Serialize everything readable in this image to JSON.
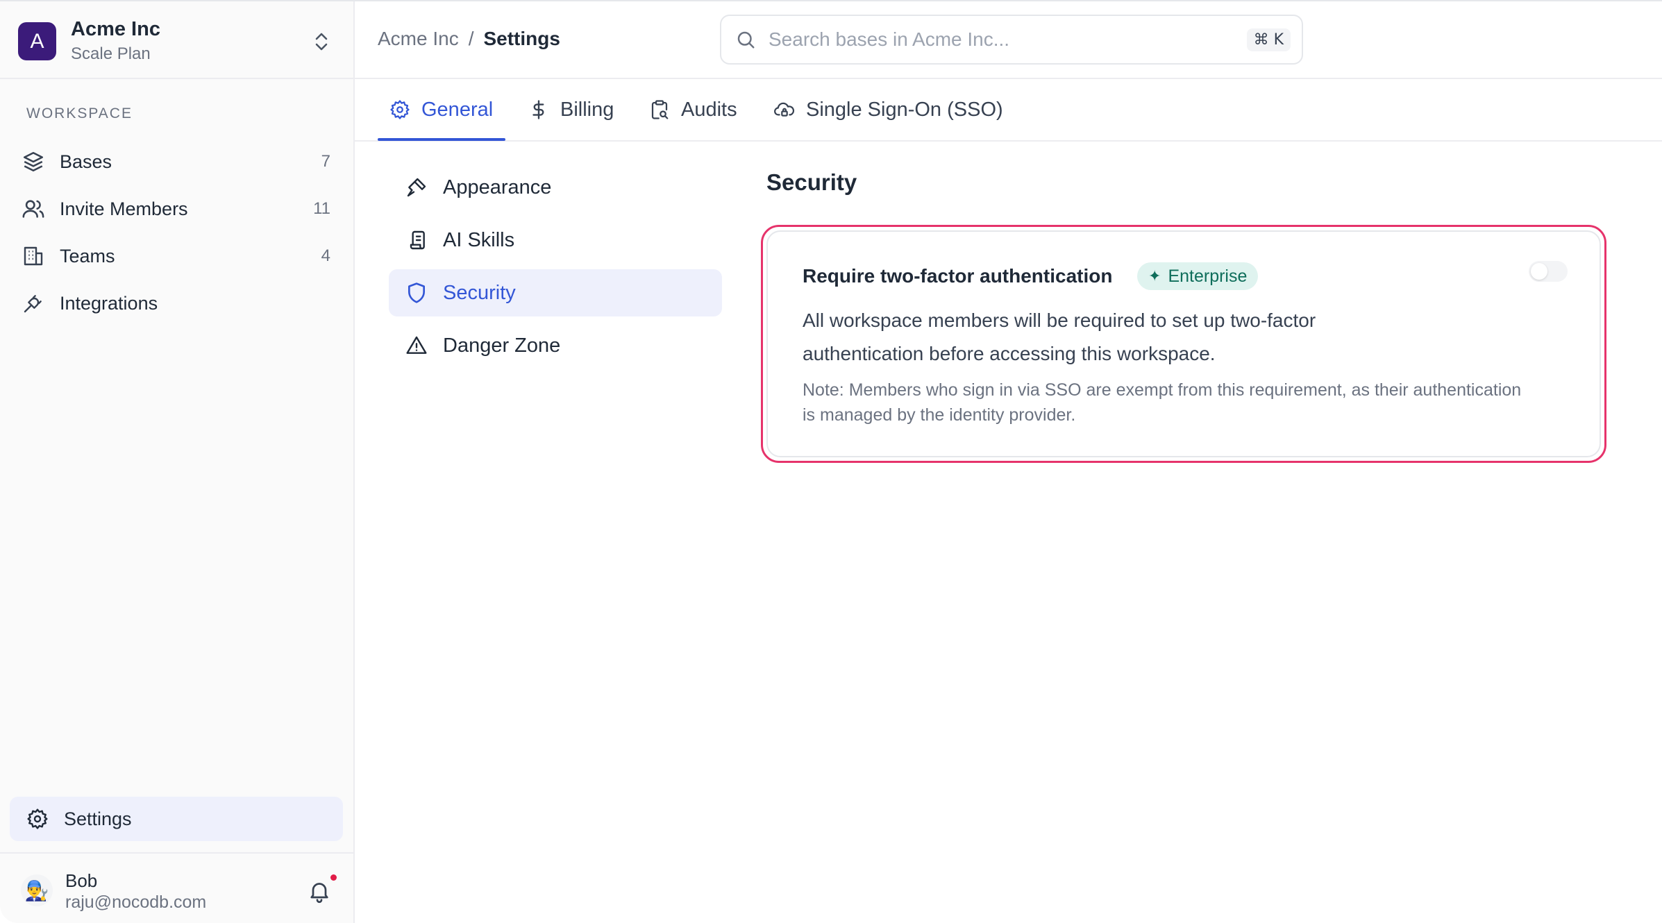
{
  "workspace": {
    "avatar_letter": "A",
    "name": "Acme Inc",
    "plan": "Scale Plan"
  },
  "sidebar": {
    "section_label": "WORKSPACE",
    "items": [
      {
        "label": "Bases",
        "count": "7",
        "icon": "layers-icon"
      },
      {
        "label": "Invite Members",
        "count": "11",
        "icon": "users-icon"
      },
      {
        "label": "Teams",
        "count": "4",
        "icon": "building-icon"
      },
      {
        "label": "Integrations",
        "count": "",
        "icon": "plug-icon"
      }
    ],
    "settings_label": "Settings"
  },
  "user": {
    "name": "Bob",
    "email": "raju@nocodb.com",
    "avatar": "👨‍🔧"
  },
  "header": {
    "breadcrumb": {
      "parent": "Acme Inc",
      "separator": "/",
      "current": "Settings"
    },
    "search": {
      "placeholder": "Search bases in Acme Inc...",
      "shortcut": "⌘ K"
    }
  },
  "tabs": [
    {
      "label": "General",
      "icon": "gear-icon",
      "active": true
    },
    {
      "label": "Billing",
      "icon": "dollar-icon",
      "active": false
    },
    {
      "label": "Audits",
      "icon": "clipboard-search-icon",
      "active": false
    },
    {
      "label": "Single Sign-On (SSO)",
      "icon": "cloud-lock-icon",
      "active": false
    }
  ],
  "subnav": [
    {
      "label": "Appearance",
      "icon": "brush-icon",
      "active": false
    },
    {
      "label": "AI Skills",
      "icon": "scroll-icon",
      "active": false
    },
    {
      "label": "Security",
      "icon": "shield-icon",
      "active": true
    },
    {
      "label": "Danger Zone",
      "icon": "warning-icon",
      "active": false
    }
  ],
  "security": {
    "title": "Security",
    "setting": {
      "title": "Require two-factor authentication",
      "badge": "Enterprise",
      "enabled": false,
      "description": "All workspace members will be required to set up two-factor authentication before accessing this workspace.",
      "note": "Note: Members who sign in via SSO are exempt from this requirement, as their authentication is managed by the identity provider."
    }
  },
  "colors": {
    "accent": "#3356d6",
    "highlight_border": "#e6336b",
    "badge_bg": "#dff3ef",
    "badge_text": "#0f6e5b",
    "workspace_avatar": "#3b1b7a"
  }
}
